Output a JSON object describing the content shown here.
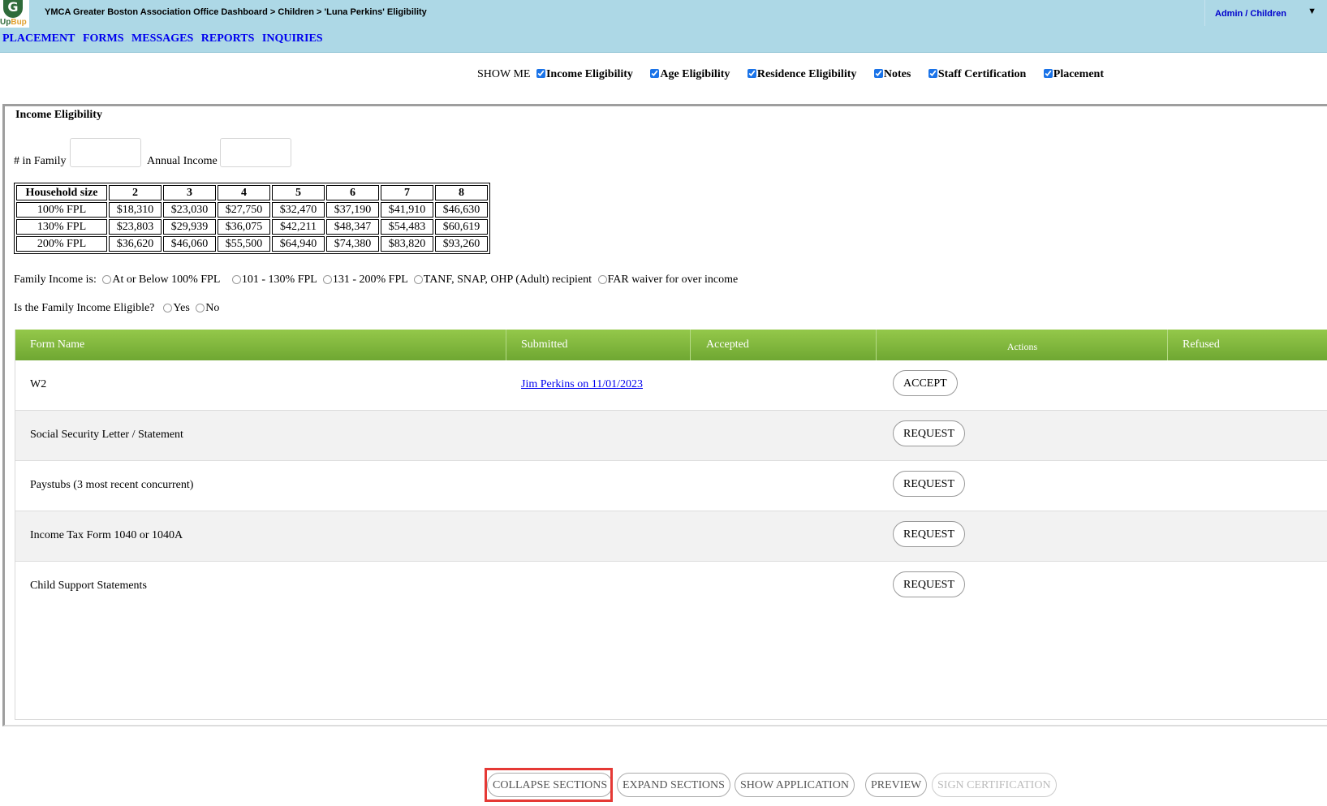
{
  "header": {
    "logo_text_a": "Up",
    "logo_text_b": "Bup",
    "breadcrumb": "YMCA Greater Boston Association Office Dashboard > Children > 'Luna Perkins' Eligibility",
    "admin_menu": "Admin / Children",
    "nav": [
      "PLACEMENT",
      "FORMS",
      "MESSAGES",
      "REPORTS",
      "INQUIRIES"
    ]
  },
  "show_me": {
    "label": "SHOW ME",
    "options": [
      "Income Eligibility",
      "Age Eligibility",
      "Residence Eligibility",
      "Notes",
      "Staff Certification",
      "Placement"
    ]
  },
  "section": {
    "title": "Income Eligibility",
    "family_label": "# in Family",
    "income_label": "Annual Income",
    "family_value": "",
    "income_value": ""
  },
  "fpl_table": {
    "headers": [
      "Household size",
      "2",
      "3",
      "4",
      "5",
      "6",
      "7",
      "8"
    ],
    "rows": [
      [
        "100% FPL",
        "$18,310",
        "$23,030",
        "$27,750",
        "$32,470",
        "$37,190",
        "$41,910",
        "$46,630"
      ],
      [
        "130% FPL",
        "$23,803",
        "$29,939",
        "$36,075",
        "$42,211",
        "$48,347",
        "$54,483",
        "$60,619"
      ],
      [
        "200% FPL",
        "$36,620",
        "$46,060",
        "$55,500",
        "$64,940",
        "$74,380",
        "$83,820",
        "$93,260"
      ]
    ]
  },
  "family_income": {
    "label": "Family Income is:",
    "options": [
      "At or Below 100% FPL",
      "101 - 130% FPL",
      "131 - 200% FPL",
      "TANF, SNAP, OHP (Adult) recipient",
      "FAR waiver for over income"
    ]
  },
  "eligible": {
    "label": "Is the Family Income Eligible?",
    "options": [
      "Yes",
      "No"
    ]
  },
  "forms": {
    "headers": [
      "Form Name",
      "Submitted",
      "Accepted",
      "Actions",
      "Refused"
    ],
    "rows": [
      {
        "name": "W2",
        "submitted": "Jim Perkins on 11/01/2023",
        "action": "ACCEPT"
      },
      {
        "name": "Social Security Letter / Statement",
        "submitted": "",
        "action": "REQUEST"
      },
      {
        "name": "Paystubs (3 most recent concurrent)",
        "submitted": "",
        "action": "REQUEST"
      },
      {
        "name": "Income Tax Form 1040 or 1040A",
        "submitted": "",
        "action": "REQUEST"
      },
      {
        "name": "Child Support Statements",
        "submitted": "",
        "action": "REQUEST"
      }
    ]
  },
  "buttons": {
    "collapse": "COLLAPSE SECTIONS",
    "expand": "EXPAND SECTIONS",
    "show_app": "SHOW APPLICATION",
    "preview": "PREVIEW",
    "sign": "SIGN CERTIFICATION"
  },
  "colors": {
    "header_bg": "#add8e6",
    "table_header_green": "#7cb53a",
    "nav_link": "#0000ee",
    "highlight": "#e53935"
  }
}
